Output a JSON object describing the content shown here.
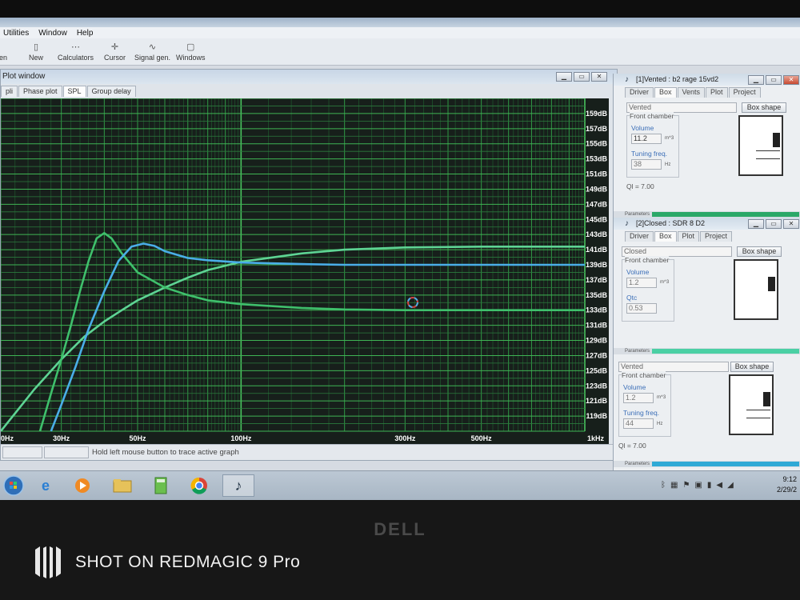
{
  "menu": {
    "items": [
      "Utilities",
      "Window",
      "Help"
    ]
  },
  "toolbar": {
    "items": [
      {
        "label": "en",
        "icon": "open-icon"
      },
      {
        "label": "New",
        "icon": "new-icon"
      },
      {
        "label": "Calculators",
        "icon": "calculator-icon"
      },
      {
        "label": "Cursor",
        "icon": "cursor-icon"
      },
      {
        "label": "Signal gen.",
        "icon": "signal-icon"
      },
      {
        "label": "Windows",
        "icon": "windows-icon"
      }
    ]
  },
  "plot_window": {
    "title": "Plot window",
    "tabs": [
      "pli",
      "Phase plot",
      "SPL",
      "Group delay"
    ],
    "active_tab": "SPL",
    "status": "Hold left mouse button to trace active graph"
  },
  "chart_data": {
    "type": "line",
    "x_scale": "log",
    "xlim": [
      20,
      1000
    ],
    "ylim": [
      117,
      161
    ],
    "x_tick_labels": [
      {
        "value": 20,
        "label": "0Hz"
      },
      {
        "value": 30,
        "label": "30Hz"
      },
      {
        "value": 50,
        "label": "50Hz"
      },
      {
        "value": 100,
        "label": "100Hz"
      },
      {
        "value": 300,
        "label": "300Hz"
      },
      {
        "value": 500,
        "label": "500Hz"
      },
      {
        "value": 1000,
        "label": "1kHz"
      }
    ],
    "y_ticks": [
      119,
      121,
      123,
      125,
      127,
      129,
      131,
      133,
      135,
      137,
      139,
      141,
      143,
      145,
      147,
      149,
      151,
      153,
      155,
      157,
      159
    ],
    "y_tick_labels": [
      "119dB",
      "121dB",
      "123dB",
      "125dB",
      "127dB",
      "129dB",
      "131dB",
      "133dB",
      "135dB",
      "137dB",
      "139dB",
      "141dB",
      "143dB",
      "145dB",
      "147dB",
      "149dB",
      "151dB",
      "153dB",
      "155dB",
      "157dB",
      "159dB"
    ],
    "grid": true,
    "series": [
      {
        "color": "#5ed494",
        "x": [
          20,
          25,
          30,
          35,
          40,
          45,
          50,
          60,
          70,
          80,
          100,
          150,
          200,
          300,
          500,
          1000
        ],
        "y": [
          117,
          122.5,
          126.5,
          129.5,
          131.5,
          133,
          134.3,
          136,
          137.3,
          138.3,
          139.4,
          140.5,
          141,
          141.3,
          141.4,
          141.4
        ]
      },
      {
        "color": "#3fc06c",
        "x": [
          26,
          28,
          30,
          32,
          34,
          36,
          38,
          40,
          42,
          45,
          50,
          60,
          70,
          80,
          100,
          150,
          200,
          300,
          500,
          1000
        ],
        "y": [
          117,
          122,
          126.5,
          131,
          135.5,
          139.5,
          142.5,
          143.2,
          142.5,
          140.5,
          138,
          136,
          135,
          134.3,
          133.8,
          133.3,
          133.1,
          133,
          133,
          133
        ]
      },
      {
        "color": "#4aaee8",
        "x": [
          28,
          30,
          33,
          36,
          40,
          44,
          48,
          52,
          56,
          60,
          70,
          80,
          100,
          150,
          200,
          300,
          500,
          1000
        ],
        "y": [
          117,
          120.5,
          125.5,
          130.5,
          135.5,
          139.5,
          141.4,
          141.8,
          141.5,
          140.8,
          139.9,
          139.6,
          139.3,
          139.1,
          139,
          139,
          139,
          139
        ]
      }
    ]
  },
  "panels": [
    {
      "title": "[1]Vented : b2 rage 15vd2",
      "tabs": [
        "Driver",
        "Box",
        "Vents",
        "Plot",
        "Project"
      ],
      "active_tab": "Box",
      "type_label": "Vented",
      "box_shape_label": "Box shape",
      "group_label": "Front chamber",
      "volume_label": "Volume",
      "volume_value": "11.2",
      "volume_unit": "m^3",
      "param_label": "Tuning freq.",
      "param_value": "38",
      "param_unit": "Hz",
      "ql_text": "Ql = 7.00",
      "strip_label": "Parameters",
      "strip_color": "#2aa868"
    },
    {
      "title": "[2]Closed : SDR 8 D2",
      "tabs": [
        "Driver",
        "Box",
        "Plot",
        "Project"
      ],
      "active_tab": "Box",
      "type_label": "Closed",
      "box_shape_label": "Box shape",
      "group_label": "Front chamber",
      "volume_label": "Volume",
      "volume_value": "1.2",
      "volume_unit": "m^3",
      "param_label": "Qtc",
      "param_value": "0.53",
      "param_unit": "",
      "strip_label": "Parameters",
      "strip_color": "#4ad0a4"
    },
    {
      "type_label": "Vented",
      "box_shape_label": "Box shape",
      "group_label": "Front chamber",
      "volume_label": "Volume",
      "volume_value": "1.2",
      "volume_unit": "m^3",
      "param_label": "Tuning freq.",
      "param_value": "44",
      "param_unit": "Hz",
      "ql_text": "Ql = 7.00",
      "strip_label": "Parameters",
      "strip_color": "#2fa9d6"
    }
  ],
  "taskbar": {
    "apps": [
      "start-icon",
      "internet-explorer-icon",
      "media-player-icon",
      "folder-icon",
      "calculator-icon",
      "chrome-icon",
      "winisd-icon"
    ],
    "time": "9:12 ",
    "date": "2/29/2"
  },
  "laptop_brand": "DELL",
  "watermark": "SHOT ON REDMAGIC 9 Pro"
}
